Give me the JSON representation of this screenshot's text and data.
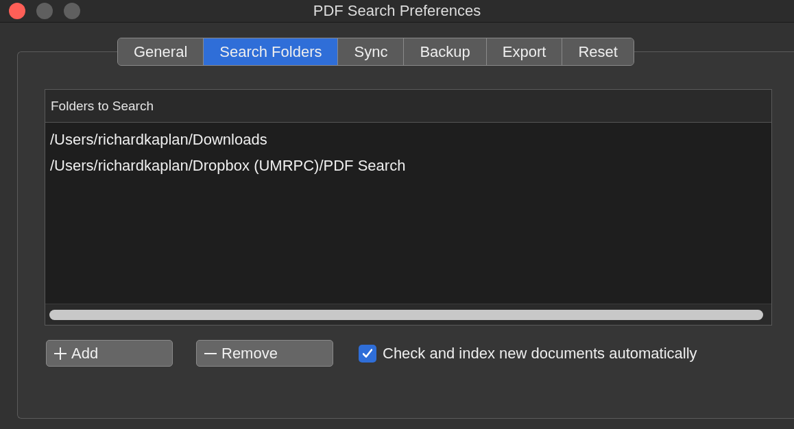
{
  "window": {
    "title": "PDF Search Preferences"
  },
  "tabs": [
    {
      "label": "General",
      "selected": false
    },
    {
      "label": "Search Folders",
      "selected": true
    },
    {
      "label": "Sync",
      "selected": false
    },
    {
      "label": "Backup",
      "selected": false
    },
    {
      "label": "Export",
      "selected": false
    },
    {
      "label": "Reset",
      "selected": false
    }
  ],
  "folders_table": {
    "columns": [
      "Folders to Search"
    ],
    "rows": [
      "/Users/richardkaplan/Downloads",
      "/Users/richardkaplan/Dropbox (UMRPC)/PDF Search"
    ]
  },
  "buttons": [
    {
      "kind": "add",
      "label": "Add"
    },
    {
      "kind": "remove",
      "label": "Remove"
    }
  ],
  "auto_index": {
    "label": "Check and index new documents automatically",
    "checked": true
  }
}
